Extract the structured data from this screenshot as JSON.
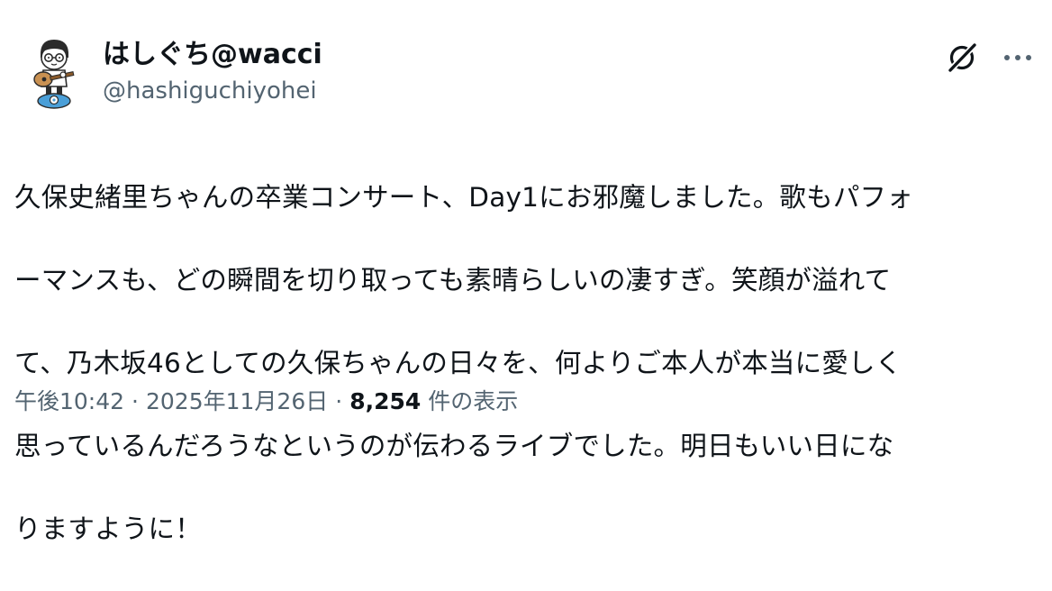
{
  "tweet": {
    "display_name": "はしぐち@wacci",
    "handle": "@hashiguchiyohei",
    "text_lines": [
      "久保史緒里ちゃんの卒業コンサート、Day1にお邪魔しました。歌もパフォ",
      "ーマンスも、どの瞬間を切り取っても素晴らしいの凄すぎ。笑顔が溢れて",
      "て、乃木坂46としての久保ちゃんの日々を、何よりご本人が本当に愛しく",
      "思っているんだろうなというのが伝わるライブでした。明日もいい日にな",
      "りますように！"
    ],
    "time": "午後10:42",
    "date": "2025年11月26日",
    "separator": "·",
    "views_count": "8,254",
    "views_label": "件の表示"
  },
  "icons": {
    "grok": "grok-slash-icon",
    "more": "more-dots-icon",
    "avatar": "avatar-guitar-illustration"
  },
  "colors": {
    "text_primary": "#0f1419",
    "text_secondary": "#536471",
    "avatar_accent": "#4a9fd8"
  }
}
